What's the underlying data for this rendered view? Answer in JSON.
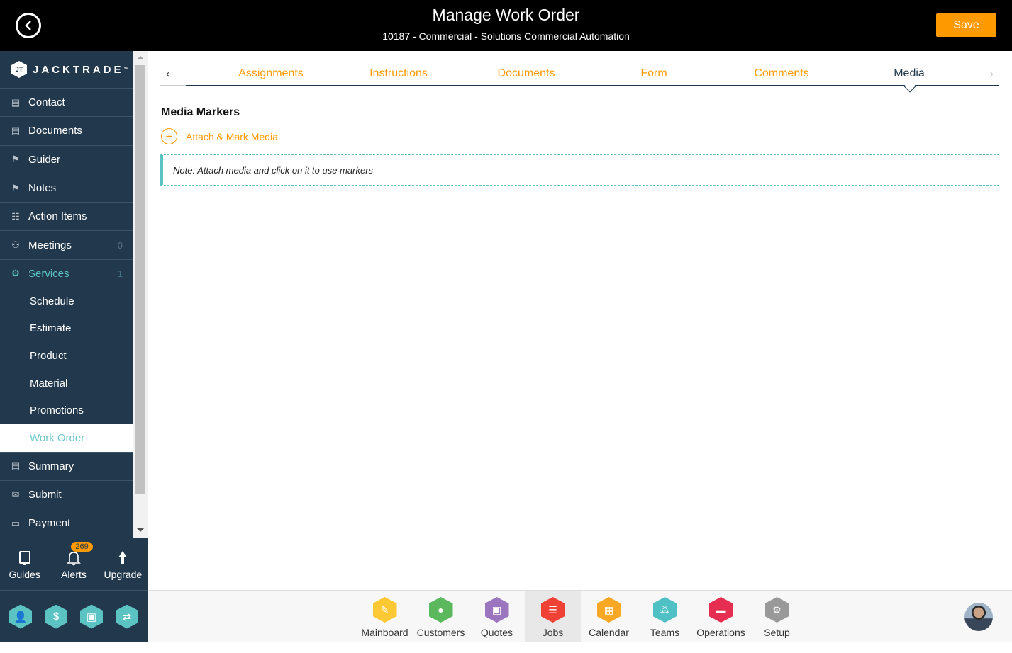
{
  "header": {
    "title": "Manage Work Order",
    "subtitle": "10187 - Commercial - Solutions Commercial Automation",
    "save_label": "Save",
    "back_icon": "chevron-left-circle-icon"
  },
  "brand": {
    "name": "JACKTRADE",
    "trademark": "™",
    "logo_mark": "JT"
  },
  "sidebar": {
    "items": [
      {
        "label": "Contact",
        "icon": "contact-book-icon",
        "glyph": "▤"
      },
      {
        "label": "Documents",
        "icon": "document-book-icon",
        "glyph": "▤"
      },
      {
        "label": "Guider",
        "icon": "signpost-icon",
        "glyph": "⚑"
      },
      {
        "label": "Notes",
        "icon": "signpost-icon",
        "glyph": "⚑"
      },
      {
        "label": "Action Items",
        "icon": "clipboard-icon",
        "glyph": "☷"
      },
      {
        "label": "Meetings",
        "icon": "meetings-icon",
        "glyph": "⚇",
        "count": "0"
      },
      {
        "label": "Services",
        "icon": "services-icon",
        "glyph": "⚙",
        "count": "1"
      }
    ],
    "sub_items": [
      {
        "label": "Schedule"
      },
      {
        "label": "Estimate"
      },
      {
        "label": "Product"
      },
      {
        "label": "Material"
      },
      {
        "label": "Promotions"
      },
      {
        "label": "Work Order",
        "active": true
      }
    ],
    "after_items": [
      {
        "label": "Summary",
        "icon": "summary-icon",
        "glyph": "▤"
      },
      {
        "label": "Submit",
        "icon": "submit-envelope-icon",
        "glyph": "✉"
      },
      {
        "label": "Payment",
        "icon": "payment-card-icon",
        "glyph": "▭"
      }
    ],
    "tools": [
      {
        "label": "Guides",
        "icon": "book-icon"
      },
      {
        "label": "Alerts",
        "icon": "bell-icon",
        "badge": "269"
      },
      {
        "label": "Upgrade",
        "icon": "arrow-up-icon"
      }
    ],
    "quick_icons": [
      {
        "name": "user-hex-icon",
        "glyph": "👤"
      },
      {
        "name": "dollar-hex-icon",
        "glyph": "$"
      },
      {
        "name": "money-hex-icon",
        "glyph": "▣"
      },
      {
        "name": "workflow-hex-icon",
        "glyph": "⇄"
      }
    ]
  },
  "tabs": {
    "items": [
      {
        "label": "Assignments"
      },
      {
        "label": "Instructions"
      },
      {
        "label": "Documents"
      },
      {
        "label": "Form"
      },
      {
        "label": "Comments"
      },
      {
        "label": "Media",
        "active": true
      }
    ],
    "prev_icon": "chevron-left-icon",
    "next_icon": "chevron-right-icon"
  },
  "content": {
    "section_title": "Media Markers",
    "attach_label": "Attach & Mark Media",
    "note": "Note: Attach media and click on it to use markers"
  },
  "dock": {
    "items": [
      {
        "label": "Mainboard",
        "color": "#fcc934",
        "glyph": "✎"
      },
      {
        "label": "Customers",
        "color": "#5cb85c",
        "glyph": "●"
      },
      {
        "label": "Quotes",
        "color": "#9b75be",
        "glyph": "▣"
      },
      {
        "label": "Jobs",
        "color": "#ef4136",
        "glyph": "☰",
        "active": true
      },
      {
        "label": "Calendar",
        "color": "#f9a825",
        "glyph": "▦"
      },
      {
        "label": "Teams",
        "color": "#4fc1c5",
        "glyph": "⁂"
      },
      {
        "label": "Operations",
        "color": "#e62e50",
        "glyph": "▬"
      },
      {
        "label": "Setup",
        "color": "#999999",
        "glyph": "⚙"
      }
    ]
  },
  "colors": {
    "accent": "#fe9a00",
    "sidebar": "#22384c",
    "teal": "#5cc3c3"
  }
}
